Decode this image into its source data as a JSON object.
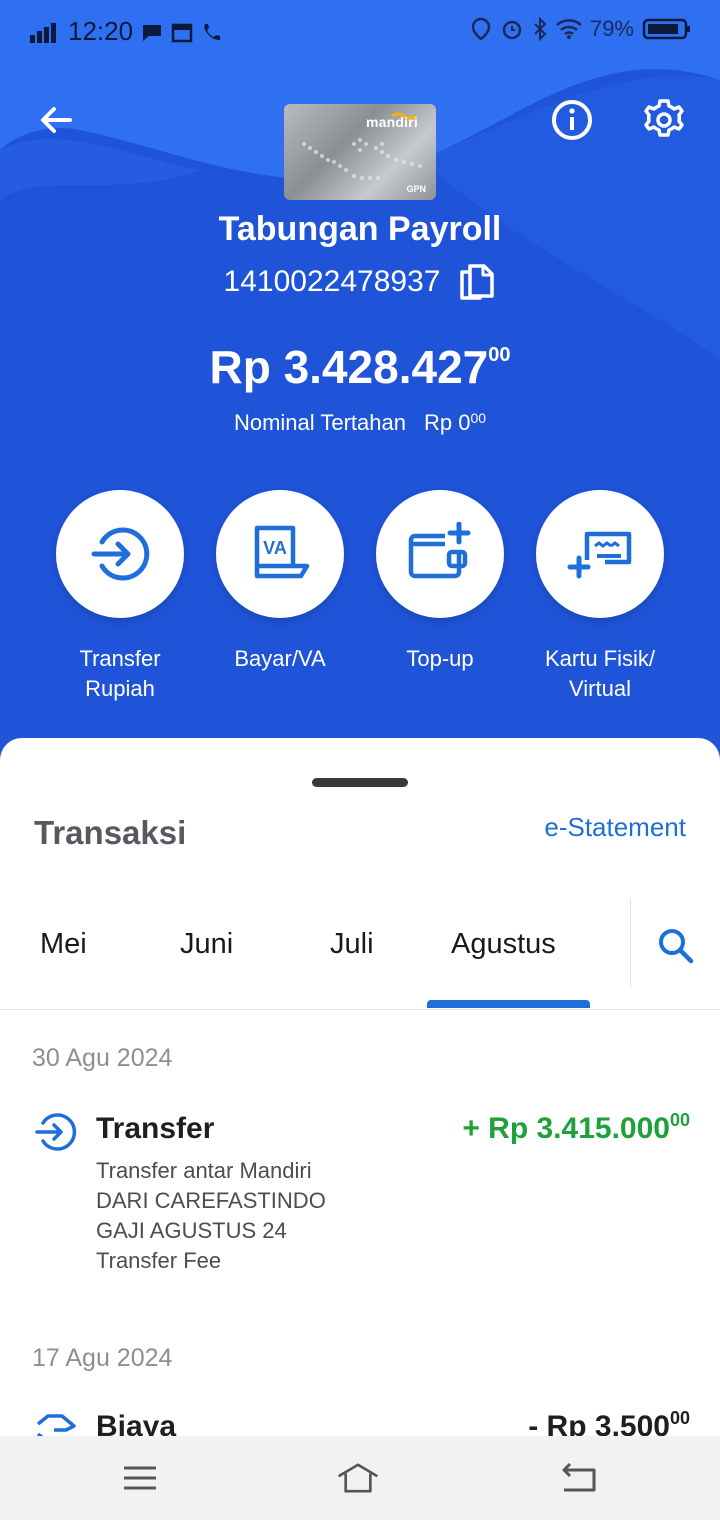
{
  "status_bar": {
    "time": "12:20",
    "battery": "79%"
  },
  "header": {
    "card_brand": "mandiri",
    "card_network": "GPN",
    "account_name": "Tabungan Payroll",
    "account_number": "1410022478937",
    "balance": {
      "currency": "Rp",
      "amount": "Rp 3.428.427",
      "decimals": "00"
    },
    "hold": {
      "label": "Nominal Tertahan",
      "value": "Rp 0",
      "decimals": "00"
    }
  },
  "actions": [
    {
      "label_line1": "Transfer",
      "label_line2": "Rupiah",
      "icon": "transfer-icon"
    },
    {
      "label_line1": "Bayar/VA",
      "label_line2": "",
      "icon": "va-icon"
    },
    {
      "label_line1": "Top-up",
      "label_line2": "",
      "icon": "wallet-add-icon"
    },
    {
      "label_line1": "Kartu Fisik/",
      "label_line2": "Virtual",
      "icon": "card-add-icon"
    }
  ],
  "transactions": {
    "title": "Transaksi",
    "estatement_label": "e-Statement",
    "tabs": [
      "Mei",
      "Juni",
      "Juli",
      "Agustus"
    ],
    "active_tab": "Agustus",
    "groups": [
      {
        "date": "30 Agu 2024",
        "items": [
          {
            "title": "Transfer",
            "amount": "+ Rp 3.415.000",
            "decimals": "00",
            "type": "credit",
            "desc_lines": [
              "Transfer antar Mandiri",
              "DARI CAREFASTINDO",
              "GAJI AGUSTUS 24",
              "Transfer Fee"
            ]
          }
        ]
      },
      {
        "date": "17 Agu 2024",
        "items": [
          {
            "title": "Biaya",
            "amount": "- Rp 3.500",
            "decimals": "00",
            "type": "debit"
          }
        ]
      }
    ]
  },
  "colors": {
    "primary_blue": "#1f54d9",
    "light_blue": "#2d6df0",
    "accent": "#1e6fd9",
    "credit_green": "#1ea03a"
  }
}
